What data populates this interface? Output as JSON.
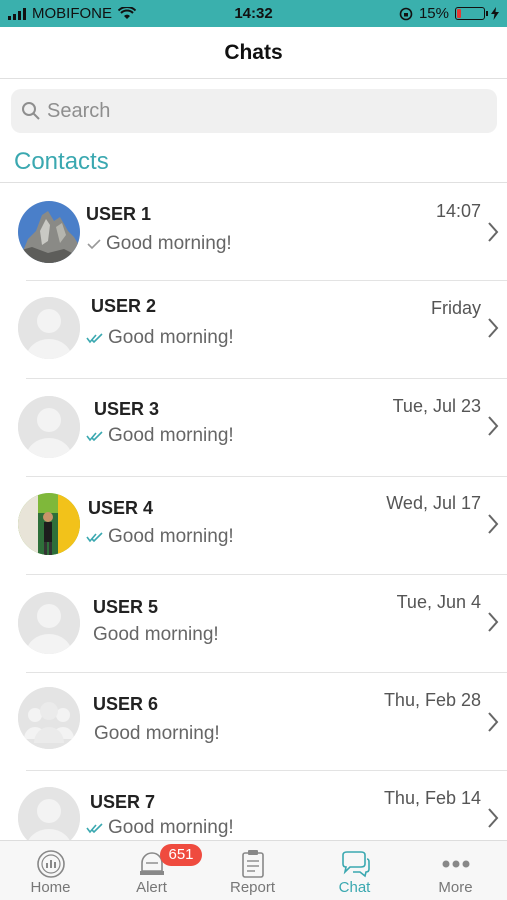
{
  "status": {
    "carrier": "MOBIFONE",
    "time": "14:32",
    "battery": "15%"
  },
  "header": {
    "title": "Chats"
  },
  "search": {
    "placeholder": "Search"
  },
  "section": {
    "title": "Contacts"
  },
  "chats": [
    {
      "name": "USER 1",
      "date": "14:07",
      "message": "Good morning!",
      "receipt": "single-check",
      "avatar": "mountain-photo"
    },
    {
      "name": "USER 2",
      "date": "Friday",
      "message": "Good morning!",
      "receipt": "double-check",
      "avatar": "placeholder"
    },
    {
      "name": "USER 3",
      "date": "Tue, Jul 23",
      "message": "Good morning!",
      "receipt": "double-check",
      "avatar": "placeholder"
    },
    {
      "name": "USER 4",
      "date": "Wed, Jul 17",
      "message": "Good morning!",
      "receipt": "double-check",
      "avatar": "person-photo"
    },
    {
      "name": "USER 5",
      "date": "Tue, Jun 4",
      "message": "Good morning!",
      "receipt": "none",
      "avatar": "placeholder"
    },
    {
      "name": "USER 6",
      "date": "Thu, Feb 28",
      "message": "Good morning!",
      "receipt": "none",
      "avatar": "group-placeholder"
    },
    {
      "name": "USER 7",
      "date": "Thu, Feb 14",
      "message": "Good morning!",
      "receipt": "double-check",
      "avatar": "placeholder"
    }
  ],
  "tabs": [
    {
      "label": "Home",
      "icon": "home-icon"
    },
    {
      "label": "Alert",
      "icon": "alert-icon",
      "badge": "651"
    },
    {
      "label": "Report",
      "icon": "report-icon"
    },
    {
      "label": "Chat",
      "icon": "chat-icon",
      "active": true
    },
    {
      "label": "More",
      "icon": "more-icon"
    }
  ],
  "colors": {
    "accent": "#3aa8b0",
    "statusbar": "#3ab0ad",
    "badge": "#ef4b3f"
  }
}
